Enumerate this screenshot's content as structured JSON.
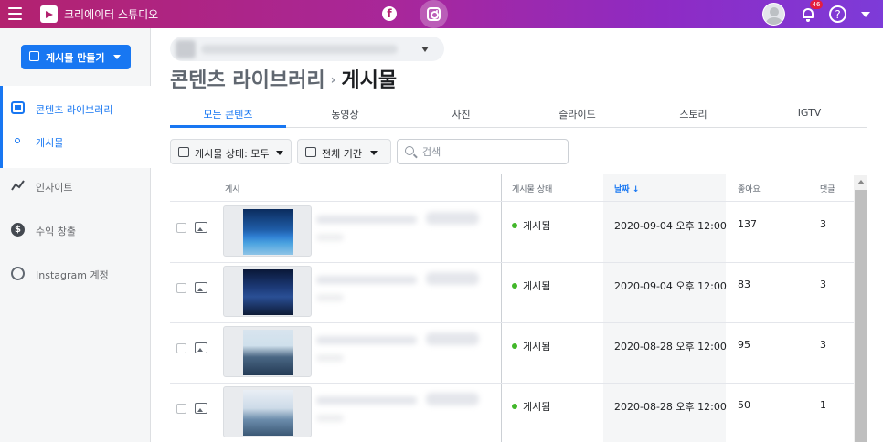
{
  "topbar": {
    "app_title": "크리에이터 스튜디오",
    "notification_count": "46",
    "help_symbol": "?",
    "icons": [
      "menu-icon",
      "creator-studio-logo",
      "facebook-icon",
      "instagram-icon",
      "avatar",
      "bell-icon",
      "help-icon",
      "chevron-down-icon"
    ]
  },
  "sidebar": {
    "create_button": "게시물 만들기",
    "items": [
      {
        "label": "콘텐츠 라이브러리",
        "icon": "content-library-icon",
        "active": true
      },
      {
        "label": "게시물",
        "icon": "dot-icon",
        "active": true
      },
      {
        "label": "인사이트",
        "icon": "insights-icon",
        "active": false
      },
      {
        "label": "수익 창출",
        "icon": "dollar-icon",
        "active": false
      },
      {
        "label": "Instagram 계정",
        "icon": "account-settings-icon",
        "active": false
      }
    ]
  },
  "main": {
    "breadcrumb": {
      "parent": "콘텐츠 라이브러리",
      "separator": "›",
      "current": "게시물"
    },
    "tabs": [
      "모든 콘텐츠",
      "동영상",
      "사진",
      "슬라이드",
      "스토리",
      "IGTV"
    ],
    "active_tab": "모든 콘텐츠",
    "filters": {
      "status_label": "게시물 상태: 모두",
      "period_label": "전체 기간"
    },
    "search": {
      "placeholder": "검색",
      "value": ""
    },
    "table": {
      "headers": {
        "post": "게시",
        "status": "게시물 상태",
        "date": "날짜 ↓",
        "likes": "좋아요",
        "comments": "댓글"
      },
      "rows": [
        {
          "status": "게시됨",
          "date": "2020-09-04 오후 12:00",
          "likes": "137",
          "comments": "3"
        },
        {
          "status": "게시됨",
          "date": "2020-09-04 오후 12:00",
          "likes": "83",
          "comments": "3"
        },
        {
          "status": "게시됨",
          "date": "2020-08-28 오후 12:00",
          "likes": "95",
          "comments": "3"
        },
        {
          "status": "게시됨",
          "date": "2020-08-28 오후 12:00",
          "likes": "50",
          "comments": "1"
        }
      ]
    }
  },
  "colors": {
    "accent": "#1877f2",
    "published": "#42b72a",
    "topbar_start": "#b3226f",
    "topbar_end": "#7d3bd8"
  }
}
